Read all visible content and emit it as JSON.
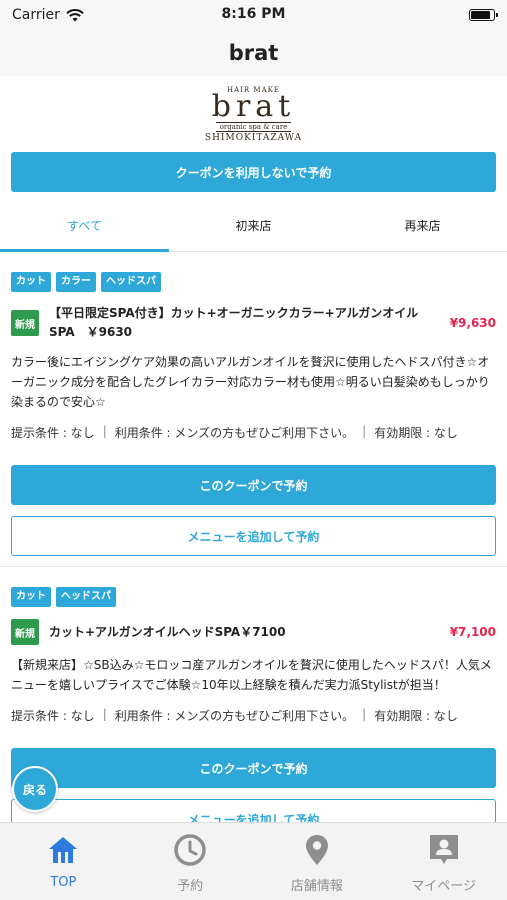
{
  "status_bar": {
    "carrier": "Carrier",
    "time": "8:16 PM"
  },
  "nav": {
    "title": "brat"
  },
  "logo": {
    "top": "HAIR MAKE",
    "main": "brat",
    "sub": "organic spa & care",
    "bottom": "SHIMOKITAZAWA"
  },
  "no_coupon_button": "クーポンを利用しないで予約",
  "filter_tabs": [
    "すべて",
    "初来店",
    "再来店"
  ],
  "coupons": [
    {
      "tags": [
        "カット",
        "カラー",
        "ヘッドスパ"
      ],
      "badge": "新規",
      "title": "【平日限定SPA付き】カット+オーガニックカラー+アルガンオイルSPA　￥9630",
      "price": "¥9,630",
      "description": "カラー後にエイジングケア効果の高いアルガンオイルを贅沢に使用したヘドスパ付き☆オーガニック成分を配合したグレイカラー対応カラー材も使用☆明るい白髪染めもしっかり染まるので安心☆",
      "conditions": [
        "提示条件 : なし",
        "利用条件 : メンズの方もぜひご利用下さい。",
        "有効期限 : なし"
      ],
      "book_button": "このクーポンで予約",
      "add_menu_button": "メニューを追加して予約"
    },
    {
      "tags": [
        "カット",
        "ヘッドスパ"
      ],
      "badge": "新規",
      "title": "カット+アルガンオイルヘッドSPA￥7100",
      "price": "¥7,100",
      "description": "【新規来店】☆SB込み☆モロッコ産アルガンオイルを贅沢に使用したヘッドスパ！人気メニューを嬉しいプライスでご体験☆10年以上経験を積んだ実力派Stylistが担当！",
      "conditions": [
        "提示条件 : なし",
        "利用条件 : メンズの方もぜひご利用下さい。",
        "有効期限 : なし"
      ],
      "book_button": "このクーポンで予約",
      "add_menu_button": "メニューを追加して予約"
    }
  ],
  "back_button": "戻る",
  "bottom_tabs": [
    {
      "label": "TOP",
      "icon": "home-icon"
    },
    {
      "label": "予約",
      "icon": "clock-icon"
    },
    {
      "label": "店舗情報",
      "icon": "map-pin-icon"
    },
    {
      "label": "マイページ",
      "icon": "profile-icon"
    }
  ],
  "colors": {
    "accent": "#2ea8d8",
    "price": "#e2264d",
    "badge": "#2d9a4e",
    "active_tab": "#2e7be0"
  }
}
